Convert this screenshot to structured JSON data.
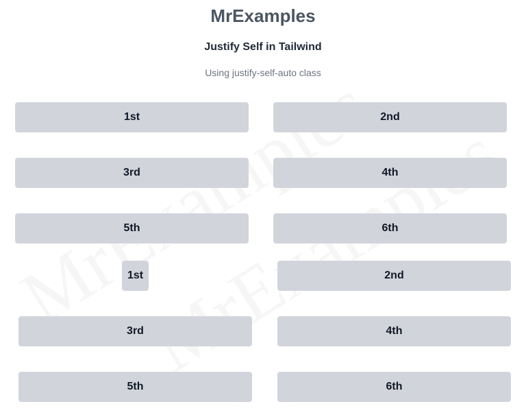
{
  "header": {
    "title": "MrExamples",
    "subtitle": "Justify Self in Tailwind",
    "description": "Using justify-self-auto class"
  },
  "watermark": "MrExamples",
  "grid1": {
    "items": [
      "1st",
      "2nd",
      "3rd",
      "4th",
      "5th",
      "6th"
    ]
  },
  "grid2": {
    "items": [
      "1st",
      "2nd",
      "3rd",
      "4th",
      "5th",
      "6th"
    ]
  },
  "colors": {
    "box_background": "#d1d5db",
    "title": "#4b5563",
    "subtitle": "#1f2937",
    "description": "#6b7280"
  }
}
